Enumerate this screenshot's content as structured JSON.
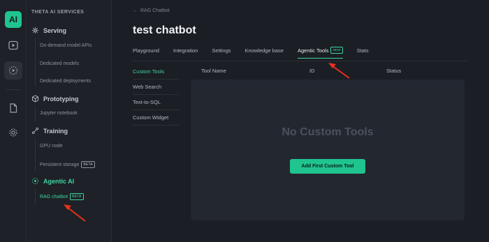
{
  "rail": {
    "logo_text": "AI",
    "icons": [
      "play-square-icon",
      "sparkle-play-icon",
      "document-icon",
      "gear-icon"
    ]
  },
  "sidebar": {
    "header": "THETA AI SERVICES",
    "groups": [
      {
        "label": "Serving",
        "items": [
          {
            "label": "On-demand model APIs"
          },
          {
            "label": "Dedicated models"
          },
          {
            "label": "Dedicated deployments"
          }
        ]
      },
      {
        "label": "Prototyping",
        "items": [
          {
            "label": "Jupyter notebook"
          }
        ]
      },
      {
        "label": "Training",
        "items": [
          {
            "label": "GPU node"
          },
          {
            "label": "Persistent storage",
            "badge": "BETA"
          }
        ]
      },
      {
        "label": "Agentic AI",
        "items": [
          {
            "label": "RAG chatbot",
            "badge": "BETA"
          }
        ]
      }
    ]
  },
  "breadcrumb": {
    "back_label": "RAG Chatbot"
  },
  "page": {
    "title": "test chatbot"
  },
  "tabs": [
    {
      "label": "Playground"
    },
    {
      "label": "Integration"
    },
    {
      "label": "Settings"
    },
    {
      "label": "Knowledge base"
    },
    {
      "label": "Agentic Tools",
      "badge": "NEW"
    },
    {
      "label": "Stats"
    }
  ],
  "tools_nav": [
    {
      "label": "Custom Tools"
    },
    {
      "label": "Web Search"
    },
    {
      "label": "Text-to-SQL"
    },
    {
      "label": "Custom Widget"
    }
  ],
  "table": {
    "columns": [
      "Tool Name",
      "ID",
      "Status"
    ],
    "empty_text": "No Custom Tools",
    "add_button": "Add First Custom Tool"
  },
  "colors": {
    "accent": "#1fc48f",
    "annotation": "#e8321e"
  }
}
